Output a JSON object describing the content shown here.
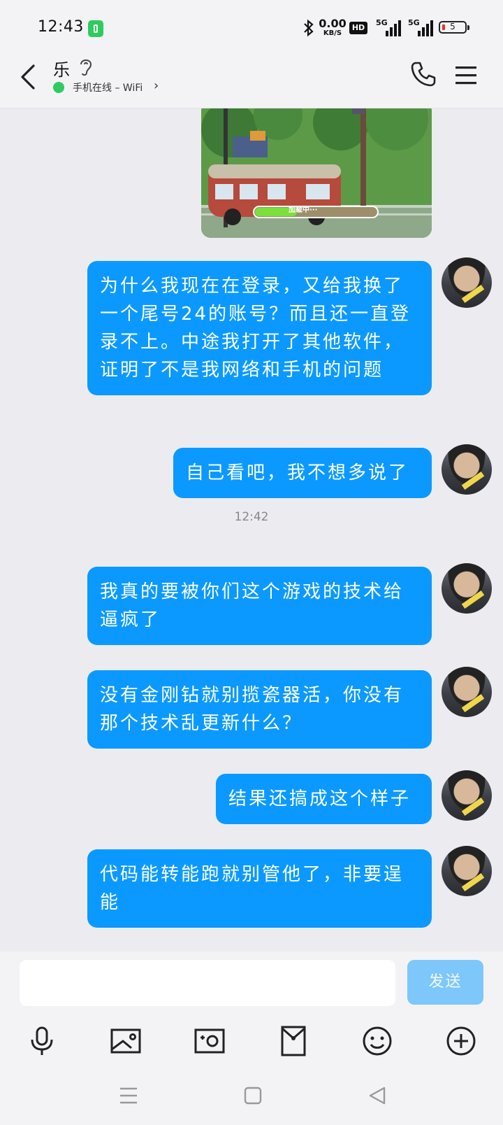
{
  "status_bar": {
    "time": "12:43",
    "net_speed_value": "0.00",
    "net_speed_unit": "KB/S",
    "hd_label": "HD",
    "sim1_label": "5G",
    "sim2_label": "5G",
    "battery_level": "5"
  },
  "header": {
    "contact_name": "乐",
    "online_status": "手机在线 – WiFi"
  },
  "chat": {
    "image_overlay_text": "加载中···",
    "messages": [
      {
        "text": "为什么我现在在登录，又给我换了一个尾号24的账号？而且还一直登录不上。中途我打开了其他软件，证明了不是我网络和手机的问题"
      },
      {
        "text": "自己看吧，我不想多说了"
      },
      {
        "text": "我真的要被你们这个游戏的技术给逼疯了"
      },
      {
        "text": "没有金刚钻就别揽瓷器活，你没有那个技术乱更新什么？"
      },
      {
        "text": "结果还搞成这个样子"
      },
      {
        "text": "代码能转能跑就别管他了，非要逞能"
      }
    ],
    "time_divider": "12:42"
  },
  "input": {
    "placeholder": "",
    "send_label": "发送"
  },
  "colors": {
    "bubble": "#0b99ff",
    "send_disabled": "#7ec7fb",
    "online": "#2ecb5e"
  }
}
